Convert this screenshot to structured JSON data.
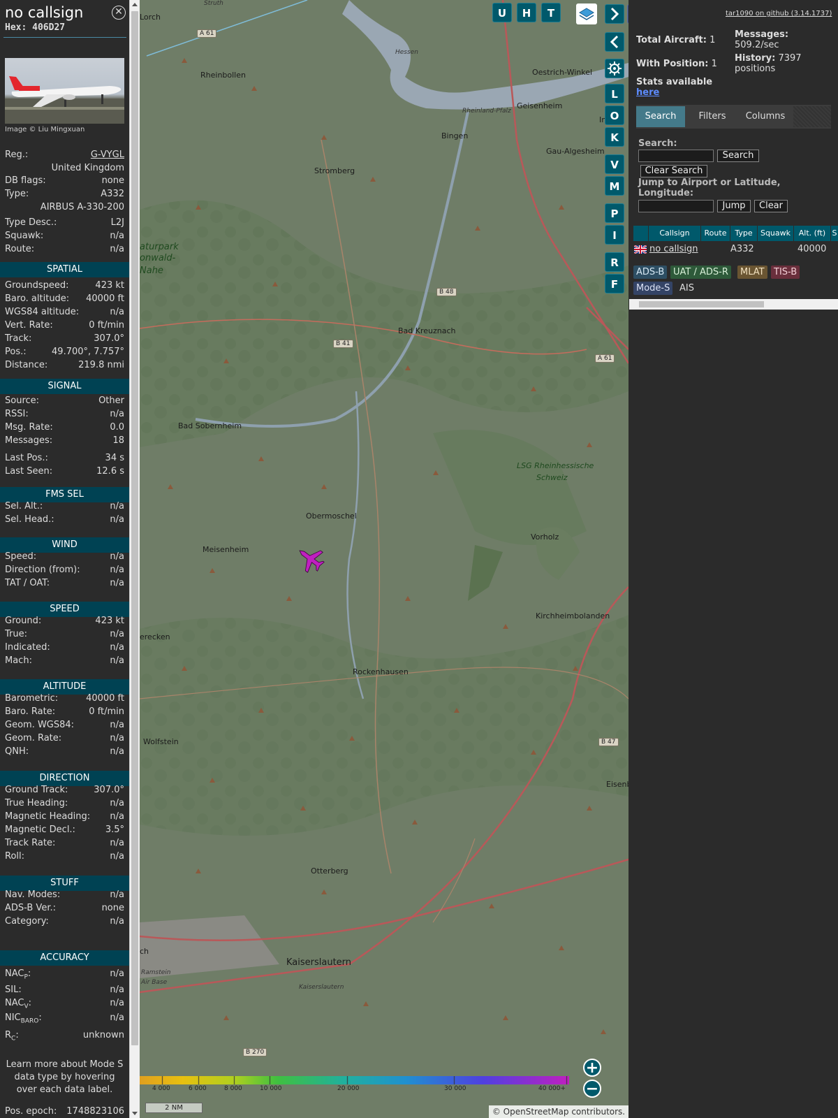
{
  "header": {
    "callsign": "no callsign",
    "hex": "Hex: 406D27"
  },
  "photo_credit": "Image © Liu Mingxuan",
  "info": [
    {
      "label": "Reg.:",
      "value": "G-VYGL",
      "link": true,
      "top": 0
    },
    {
      "label": "",
      "value": "United Kingdom"
    },
    {
      "label": "DB flags:",
      "value": "none"
    },
    {
      "label": "Type:",
      "value": "A332"
    },
    {
      "label": "",
      "value": "AIRBUS A-330-200"
    },
    {
      "label": "Type Desc.:",
      "value": "L2J"
    },
    {
      "label": "Squawk:",
      "value": "n/a"
    },
    {
      "label": "Route:",
      "value": "n/a"
    }
  ],
  "sections": {
    "spatial": "SPATIAL",
    "signal": "SIGNAL",
    "fms": "FMS SEL",
    "wind": "WIND",
    "speed": "SPEED",
    "altitude": "ALTITUDE",
    "direction": "DIRECTION",
    "stuff": "STUFF",
    "accuracy": "ACCURACY"
  },
  "spatial": [
    {
      "label": "Groundspeed:",
      "value": "423 kt"
    },
    {
      "label": "Baro. altitude:",
      "value": "40000 ft"
    },
    {
      "label": "WGS84 altitude:",
      "value": "n/a"
    },
    {
      "label": "Vert. Rate:",
      "value": "0 ft/min"
    },
    {
      "label": "Track:",
      "value": "307.0°"
    },
    {
      "label": "Pos.:",
      "value": "49.700°, 7.757°"
    },
    {
      "label": "Distance:",
      "value": "219.8 nmi"
    }
  ],
  "signal": [
    {
      "label": "Source:",
      "value": "Other"
    },
    {
      "label": "RSSI:",
      "value": "n/a"
    },
    {
      "label": "Msg. Rate:",
      "value": "0.0"
    },
    {
      "label": "Messages:",
      "value": "18"
    },
    {
      "label": "Last Pos.:",
      "value": "34 s"
    },
    {
      "label": "Last Seen:",
      "value": "12.6 s"
    }
  ],
  "fms": [
    {
      "label": "Sel. Alt.:",
      "value": "n/a"
    },
    {
      "label": "Sel. Head.:",
      "value": "n/a"
    }
  ],
  "wind": [
    {
      "label": "Speed:",
      "value": "n/a"
    },
    {
      "label": "Direction (from):",
      "value": "n/a"
    },
    {
      "label": "TAT / OAT:",
      "value": "n/a"
    }
  ],
  "speed": [
    {
      "label": "Ground:",
      "value": "423 kt"
    },
    {
      "label": "True:",
      "value": "n/a"
    },
    {
      "label": "Indicated:",
      "value": "n/a"
    },
    {
      "label": "Mach:",
      "value": "n/a"
    }
  ],
  "altitude": [
    {
      "label": "Barometric:",
      "value": "40000 ft"
    },
    {
      "label": "Baro. Rate:",
      "value": "0 ft/min"
    },
    {
      "label": "Geom. WGS84:",
      "value": "n/a"
    },
    {
      "label": "Geom. Rate:",
      "value": "n/a"
    },
    {
      "label": "QNH:",
      "value": "n/a"
    }
  ],
  "direction": [
    {
      "label": "Ground Track:",
      "value": "307.0°"
    },
    {
      "label": "True Heading:",
      "value": "n/a"
    },
    {
      "label": "Magnetic Heading:",
      "value": "n/a"
    },
    {
      "label": "Magnetic Decl.:",
      "value": "3.5°"
    },
    {
      "label": "Track Rate:",
      "value": "n/a"
    },
    {
      "label": "Roll:",
      "value": "n/a"
    }
  ],
  "stuff": [
    {
      "label": "Nav. Modes:",
      "value": "n/a"
    },
    {
      "label": "ADS-B Ver.:",
      "value": "none"
    },
    {
      "label": "Category:",
      "value": "n/a"
    }
  ],
  "accuracy": [
    {
      "label": "NACP:",
      "value": "n/a"
    },
    {
      "label": "SIL:",
      "value": "n/a"
    },
    {
      "label": "NACV:",
      "value": "n/a"
    },
    {
      "label": "NICBARO:",
      "value": "n/a"
    },
    {
      "label": "RC:",
      "value": "unknown"
    }
  ],
  "learn_more": "Learn more about Mode S data type by hovering over each data label.",
  "pos_epoch": {
    "label": "Pos. epoch:",
    "value": "1748823106"
  },
  "map": {
    "towns": [
      "Lorch",
      "Rheinbollen",
      "Oestrich-Winkel",
      "Geisenheim",
      "Bingen",
      "Gau-Algesheim",
      "Stromberg",
      "aturpark",
      "onwald-",
      "Nahe",
      "Bad Kreuznach",
      "Bad Sobernheim",
      "LSG Rheinhessische",
      "Schweiz",
      "Obermoschel",
      "Meisenheim",
      "Vorholz",
      "Kirchheimbolanden",
      "erecken",
      "Rockenhausen",
      "Wolfstein",
      "Eisenb",
      "Otterberg",
      "Kaiserslautern",
      "Kaiserslautern",
      "Ramstein",
      "Air Base",
      "ch",
      "In",
      "Struth",
      "Hessen",
      "Rheinland-Pfalz"
    ],
    "shields": [
      "A 61",
      "B 48",
      "B 41",
      "A 61",
      "B 47",
      "B 270"
    ],
    "buttons": [
      "U",
      "H",
      "T",
      "L",
      "O",
      "K",
      "V",
      "M",
      "P",
      "I",
      "R",
      "F"
    ],
    "colorbar_ticks": [
      "4 000",
      "6 000",
      "8 000",
      "10 000",
      "20 000",
      "30 000",
      "40 000+"
    ],
    "scale": "2 NM",
    "credit": "© OpenStreetMap contributors."
  },
  "right": {
    "github": "tar1090 on github (3.14.1737)",
    "total_label": "Total Aircraft:",
    "total_value": "1",
    "messages_label": "Messages:",
    "messages_value": "509.2/sec",
    "withpos_label": "With Position:",
    "withpos_value": "1",
    "history_label": "History:",
    "history_value": "7397",
    "history_unit": "positions",
    "stats_text": "Stats available",
    "stats_link": "here",
    "tabs": [
      "Search",
      "Filters",
      "Columns"
    ],
    "search_label": "Search:",
    "search_button": "Search",
    "clear_search_button": "Clear Search",
    "jump_label": "Jump to Airport or Latitude, Longitude:",
    "jump_button": "Jump",
    "clear_button": "Clear",
    "table_headers": [
      "Callsign",
      "Route",
      "Type",
      "Squawk",
      "Alt. (ft)",
      "S"
    ],
    "table_row": {
      "callsign": "no callsign",
      "route": "",
      "type": "A332",
      "squawk": "",
      "alt": "40000"
    },
    "badges": [
      "ADS-B",
      "UAT / ADS-R",
      "MLAT",
      "TIS-B",
      "Mode-S",
      "AIS"
    ]
  },
  "colors": {
    "header_teal": "#00596b",
    "section": "#004253",
    "aircraft": "#c020c0"
  }
}
